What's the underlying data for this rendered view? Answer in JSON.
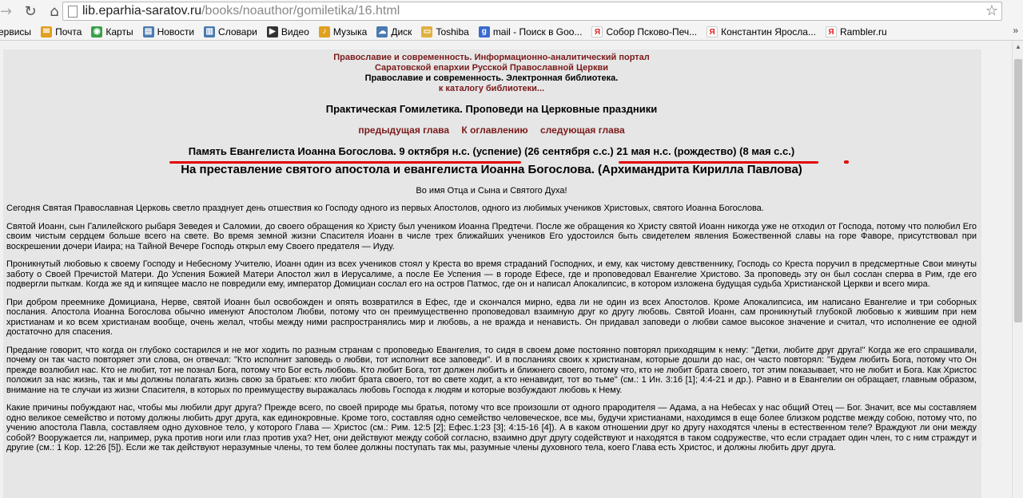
{
  "browser": {
    "url_host": "lib.eparhia-saratov.ru",
    "url_path": "/books/noauthor/gomiletika/16.html",
    "bookmarks": [
      {
        "label": "ервисы",
        "color": "#9c9c9c"
      },
      {
        "label": "Почта",
        "color": "#e0a020"
      },
      {
        "label": "Карты",
        "color": "#3aa04a"
      },
      {
        "label": "Новости",
        "color": "#4a7ab0"
      },
      {
        "label": "Словари",
        "color": "#4a7ab0"
      },
      {
        "label": "Видео",
        "color": "#333333"
      },
      {
        "label": "Музыка",
        "color": "#e0a020"
      },
      {
        "label": "Диск",
        "color": "#4a7ab0"
      },
      {
        "label": "Toshiba",
        "color": "#e0b040"
      },
      {
        "label": "mail - Поиск в Goo...",
        "color": "#3a6ad0"
      },
      {
        "label": "Собор Псково-Печ...",
        "color": "#e02020"
      },
      {
        "label": "Константин Яросла...",
        "color": "#e02020"
      },
      {
        "label": "Rambler.ru",
        "color": "#e02020"
      }
    ],
    "bookmarks_more": "»"
  },
  "header": {
    "portal_line1": "Православие и современность. Информационно-аналитический портал",
    "portal_line2": "Саратовской епархии Русской Православной Церкви",
    "library": "Православие и современность. Электронная библиотека.",
    "catalog_link": "к каталогу библиотеки..."
  },
  "book_title": "Практическая Гомилетика. Проповеди на Церковные праздники",
  "nav": {
    "prev": "предыдущая глава",
    "toc": "К оглавлению",
    "next": "следующая глава"
  },
  "memorial": {
    "part1": "Память Евангелиста Иоанна Богослова.",
    "part2": "9 октября н.с. (успение)",
    "part3": "(26 сентября с.с.)",
    "part4": "21 мая н.с. (рождество)",
    "part5": "(8 мая с.с.)"
  },
  "sermon_title": "На преставление святого апостола и евангелиста Иоанна Богослова. (Архимандрита Кирилла Павлова)",
  "invocation": "Во имя Отца и Сына и Святого Духа!",
  "paragraphs": [
    "Сегодня Святая Православная Церковь светло празднует день отшествия ко Господу одного из первых Апостолов, одного из любимых учеников Христовых, святого Иоанна Богослова.",
    "Святой Иоанн, сын Галилейского рыбаря Зеведея и Саломии, до своего обращения ко Христу был учеником Иоанна Предтечи. После же обращения ко Христу святой Иоанн никогда уже не отходил от Господа, потому что полюбил Его своим чистым сердцем больше всего на свете. Во время земной жизни Спасителя Иоанн в числе трех ближайших учеников Его удостоился быть свидетелем явления Божественной славы на горе Фаворе, присутствовал при воскрешении дочери Иаира; на Тайной Вечере Господь открыл ему Своего предателя — Иуду.",
    "Проникнутый любовью к своему Господу и Небесному Учителю, Иоанн один из всех учеников стоял у Креста во время страданий Господних, и ему, как чистому девственнику, Господь со Креста поручил в предсмертные Свои минуты заботу о Своей Пречистой Матери. До Успения Божией Матери Апостол жил в Иерусалиме, а после Ее Успения — в городе Ефесе, где и проповедовал Евангелие Христово. За проповедь эту он был сослан сперва в Рим, где его подвергли пыткам. Когда же яд и кипящее масло не повредили ему, император Домициан сослал его на остров Патмос, где он и написал Апокалипсис, в котором изложена будущая судьба Христианской Церкви и всего мира.",
    "При добром преемнике Домициана, Нерве, святой Иоанн был освобожден и опять возвратился в Ефес, где и скончался мирно, едва ли не один из всех Апостолов. Кроме Апокалипсиса, им написано Евангелие и три соборных послания. Апостола Иоанна Богослова обычно именуют Апостолом Любви, потому что он преимущественно проповедовал взаимную друг ко другу любовь. Святой Иоанн, сам проникнутый глубокой любовью к жившим при нем христианам и ко всем христианам вообще, очень желал, чтобы между ними распространялись мир и любовь, а не вражда и ненависть. Он придавал заповеди о любви самое высокое значение и считал, что исполнение ее одной достаточно для спасения.",
    "Предание говорит, что когда он глубоко состарился и не мог ходить по разным странам с проповедью Евангелия, то сидя в своем доме постоянно повторял приходящим к нему: \"Детки, любите друг друга!\" Когда же его спрашивали, почему он так часто повторяет эти слова, он отвечал: \"Кто исполнит заповедь о любви, тот исполнит все заповеди\". И в посланиях своих к христианам, которые дошли до нас, он часто повторял: \"Будем любить Бога, потому что Он прежде возлюбил нас. Кто не любит, тот не познал Бога, потому что Бог есть любовь. Кто любит Бога, тот должен любить и ближнего своего, потому что, кто не любит брата своего, тот этим показывает, что не любит и Бога. Как Христос положил за нас жизнь, так и мы должны полагать жизнь свою за братьев: кто любит брата своего, тот во свете ходит, а кто ненавидит, тот во тьме\" (см.: 1 Ин. 3:16 [1]; 4:4-21 и др.). Равно и в Евангелии он обращает, главным образом, внимание на те случаи из жизни Спасителя, в которых по преимуществу выражалась любовь Господа к людям и которые возбуждают любовь к Нему.",
    "Какие причины побуждают нас, чтобы мы любили друг друга? Прежде всего, по своей природе мы братья, потому что все произошли от одного прародителя — Адама, а на Небесах у нас общий Отец — Бог. Значит, все мы составляем одно великое семейство и потому должны любить друг друга, как единокровные. Кроме того, составляя одно семейство человеческое, все мы, будучи христианами, находимся в еще более близком родстве между собою, потому что, по учению апостола Павла, составляем одно духовное тело, у которого Глава — Христос (см.: Рим. 12:5 [2]; Ефес.1:23 [3]; 4:15-16 [4]). А в каком отношении друг ко другу находятся члены в естественном теле? Враждуют ли они между собой? Вооружается ли, например, рука против ноги или глаз против уха? Нет, они действуют между собой согласно, взаимно друг другу содействуют и находятся в таком содружестве, что если страдает один член, то с ним страждут и другие (см.: 1 Кор. 12:26 [5]). Если же так действуют неразумные члены, то тем более должны поступать так мы, разумные члены духовного тела, коего Глава есть Христос, и должны любить друг друга."
  ]
}
